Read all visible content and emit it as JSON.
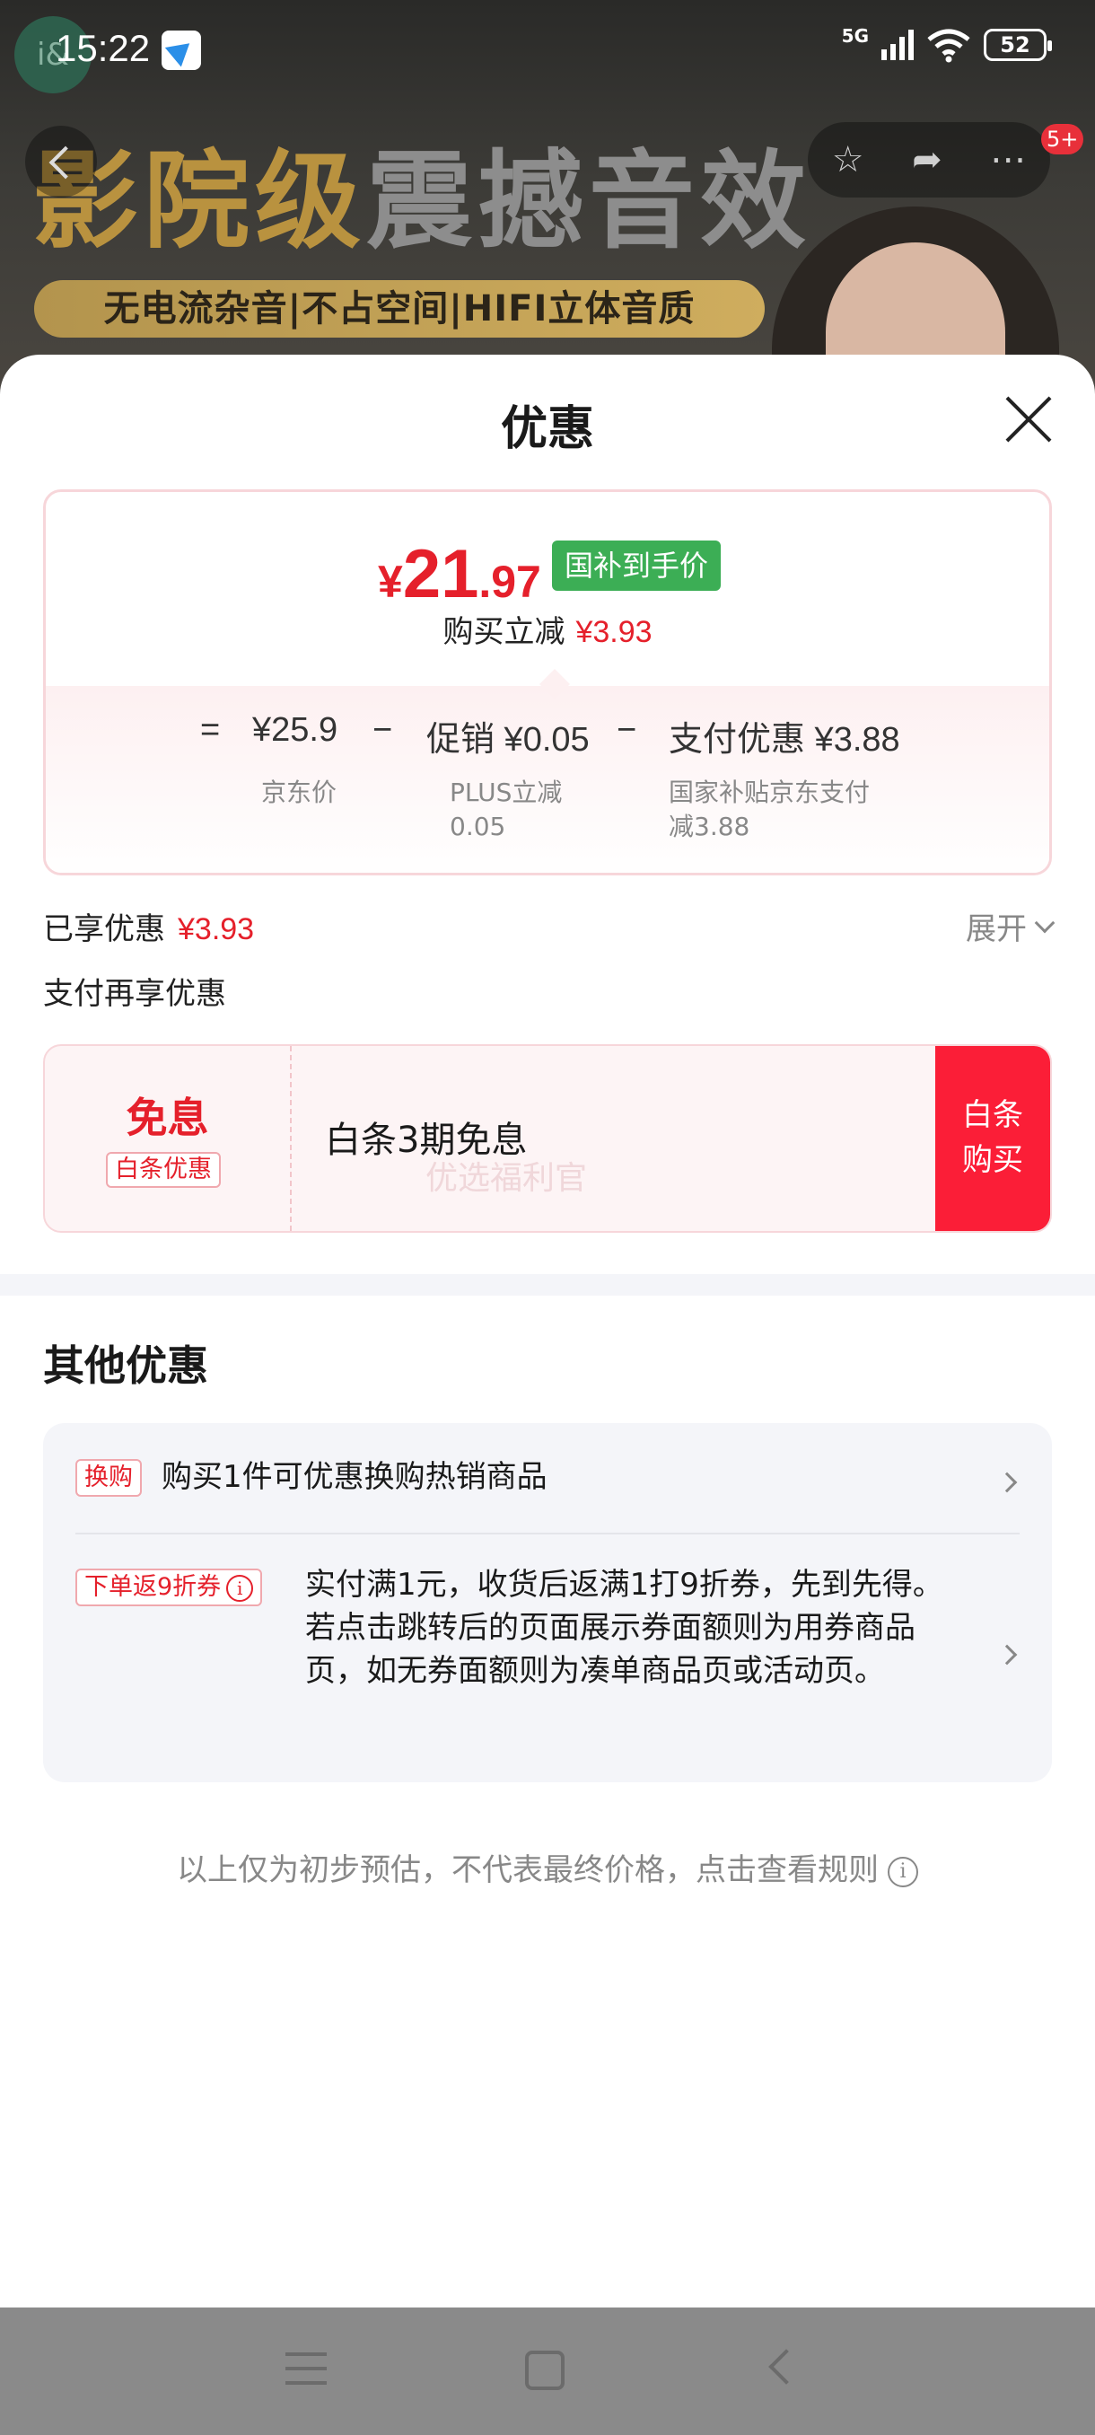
{
  "status_bar": {
    "time": "15:22",
    "network": "5G",
    "battery": "52",
    "avatar_text": "i&"
  },
  "banner": {
    "headline_gold": "影院级",
    "headline_white": "震撼音效",
    "features": "无电流杂音|不占空间|HIFI立体音质"
  },
  "nav": {
    "badge": "5+"
  },
  "sheet": {
    "title": "优惠",
    "price": {
      "currency": "¥",
      "integer": "21",
      "decimal": ".97",
      "tag": "国补到手价",
      "instant_label": "购买立减",
      "instant_value": "¥3.93"
    },
    "formula": {
      "equals": "=",
      "jd_price": "¥25.9",
      "jd_price_label": "京东价",
      "minus1": "−",
      "promo": "促销 ¥0.05",
      "promo_label_1": "PLUS立减",
      "promo_label_2": "0.05",
      "minus2": "−",
      "pay": "支付优惠 ¥3.88",
      "pay_label_1": "国家补贴京东支付",
      "pay_label_2": "减3.88"
    },
    "enjoyed_label": "已享优惠",
    "enjoyed_value": "¥3.93",
    "expand_label": "展开",
    "pay_more_label": "支付再享优惠",
    "baitiao": {
      "free_label": "免息",
      "tag": "白条优惠",
      "text": "白条3期免息",
      "watermark": "优选福利官",
      "buy_line1": "白条",
      "buy_line2": "购买"
    },
    "other": {
      "title": "其他优惠",
      "offers": [
        {
          "tag": "换购",
          "text": "购买1件可优惠换购热销商品"
        },
        {
          "tag": "下单返9折券",
          "text": "实付满1元，收货后返满1打9折券，先到先得。若点击跳转后的页面展示券面额则为用券商品页，如无券面额则为凑单商品页或活动页。"
        }
      ]
    },
    "disclaimer": "以上仅为初步预估，不代表最终价格，点击查看规则"
  },
  "colors": {
    "accent_red": "#e5202b",
    "buy_red": "#fb1e37",
    "subsidy_green": "#3cae55"
  },
  "icons": [
    "back-icon",
    "star-icon",
    "share-icon",
    "more-icon",
    "close-icon",
    "chevron-down-icon",
    "chevron-right-icon",
    "info-icon",
    "menu-icon",
    "home-icon",
    "nav-back-icon"
  ]
}
